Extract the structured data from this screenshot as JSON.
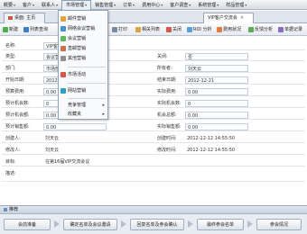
{
  "menubar": {
    "items": [
      {
        "label": "概要"
      },
      {
        "label": "客户"
      },
      {
        "label": "联系人"
      },
      {
        "label": "市场管理"
      },
      {
        "label": "销售管理"
      },
      {
        "label": "订单"
      },
      {
        "label": "费用中心"
      },
      {
        "label": "客户调查"
      },
      {
        "label": "系统管理"
      },
      {
        "label": "样品管理"
      }
    ]
  },
  "tabs": {
    "home": "桌面: 主页",
    "vip": "VIP客户交流会"
  },
  "toolbar": {
    "new": "新建",
    "list": "列表查询",
    "print": "打印",
    "related_list": "相关列表",
    "close": "关闭",
    "roi": "ROI 分析",
    "cost": "费用状况",
    "response": "反馈分析",
    "report": "单据记录"
  },
  "dropdown": {
    "items": [
      {
        "label": "邮件营销"
      },
      {
        "label": "网络会议营销"
      },
      {
        "label": "会议营销"
      },
      {
        "label": "直邮营销"
      },
      {
        "label": "其他营销"
      },
      {
        "label": "市场活动"
      },
      {
        "label": "网站营销"
      },
      {
        "label": "竞争管理"
      },
      {
        "label": "收藏夹"
      }
    ]
  },
  "form": {
    "name_label": "名称:",
    "name_value": "VIP客户交流会",
    "type_label": "类型:",
    "type_value": "会议营销",
    "closed_label": "关闭:",
    "closed_value": "否",
    "dept_label": "部门:",
    "dept_value": "市场部",
    "owner_label": "所有者:",
    "owner_value": "刘天云",
    "start_label": "开始日期:",
    "start_value": "2012-12-21",
    "end_label": "结束日期:",
    "end_value": "2012-12-21",
    "budget_label": "预算费用:",
    "budget_value": "0.00",
    "actual_label": "实际费用:",
    "actual_value": "0.00",
    "exp_count_label": "预计机会数:",
    "exp_count_value": "0",
    "act_count_label": "实际机会数:",
    "act_count_value": "0",
    "exp_amount_label": "预计机会额:",
    "exp_amount_value": "0.00",
    "act_amount_label": "机会总额:",
    "act_amount_value": "0.00",
    "exp_sales_label": "预计销售额:",
    "exp_sales_value": "0.00",
    "act_sales_label": "实际销售额:",
    "act_sales_value": "0.00",
    "creator_label": "创建人:",
    "creator_value": "刘天云",
    "created_label": "创建时间:",
    "created_value": "2012-12-12 14:55:50",
    "modifier_label": "修改人:",
    "modifier_value": "刘天云",
    "modified_label": "修改时间:",
    "modified_value": "2012-12-12 14:55:50",
    "goal_label": "目标:",
    "goal_value": "在第16届VIP交流会议",
    "desc_label": "描述:",
    "desc_value": ""
  },
  "process": {
    "title": "推荐",
    "steps": [
      {
        "label": "会前准备"
      },
      {
        "label": "确定名单及会议邀请"
      },
      {
        "label": "回复名单及参会确认"
      },
      {
        "label": "最终参会名单"
      },
      {
        "label": "参会情况"
      }
    ]
  },
  "colors": {
    "accent": "#6b8fbf",
    "menubar_border": "#a9b4c2"
  }
}
